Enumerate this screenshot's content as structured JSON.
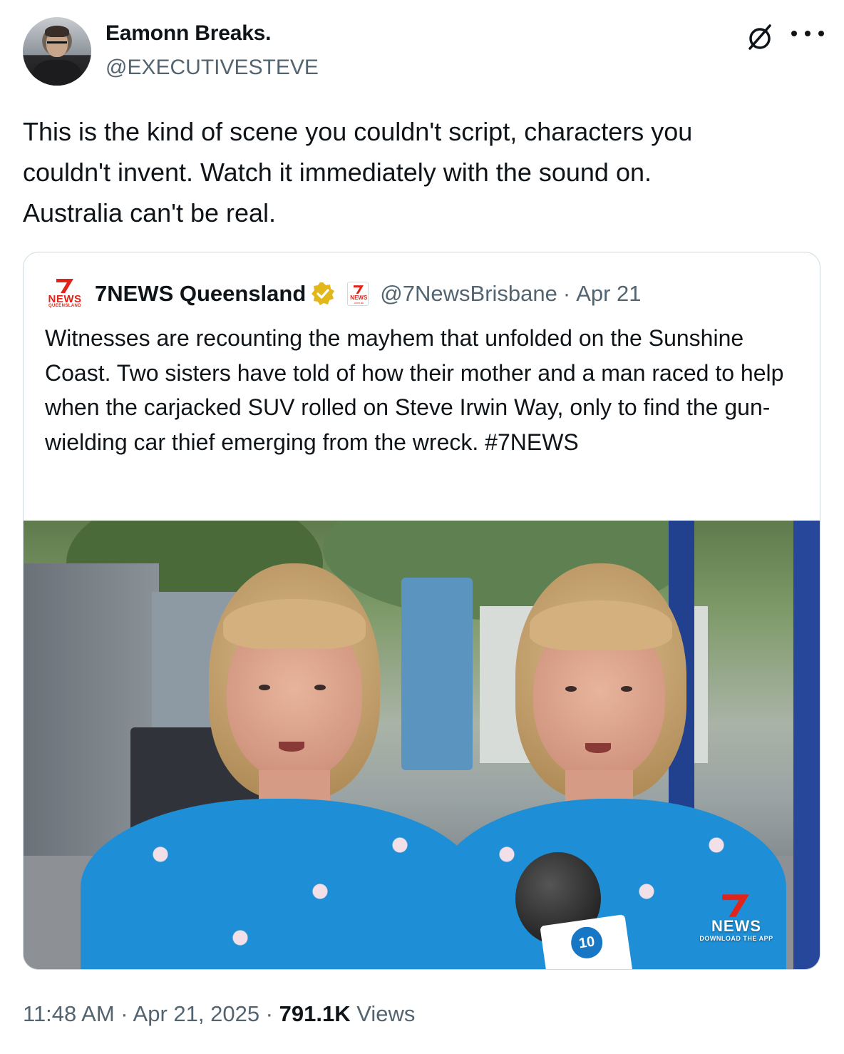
{
  "author": {
    "name": "Eamonn Breaks.",
    "handle": "@EXECUTIVESTEVE"
  },
  "tweet": {
    "text": "This is the kind of scene you couldn't script, characters you\ncouldn't invent.  Watch it immediately with the sound on.\nAustralia can't be real."
  },
  "quoted": {
    "logo_text": "NEWS",
    "logo_subtext": "QUEENSLAND",
    "name": "7NEWS Queensland",
    "affiliate_badge_text": "NEWS",
    "affiliate_badge_subtext": ".com.au",
    "handle": "@7NewsBrisbane",
    "separator": "·",
    "date": "Apr 21",
    "text": "Witnesses are recounting the mayhem that unfolded on the Sunshine Coast. Two sisters have told of how their mother and a man raced to help when the carjacked SUV rolled on Steve Irwin Way, only to find the gun-wielding car thief emerging from the wreck.  #7NEWS",
    "media": {
      "bug_text": "NEWS",
      "bug_subtext": "DOWNLOAD THE APP",
      "mic_flag_text": "10"
    }
  },
  "meta": {
    "time": "11:48 AM",
    "sep1": " · ",
    "date": "Apr 21, 2025",
    "sep2": " · ",
    "views_count": "791.1K",
    "views_label": " Views"
  },
  "colors": {
    "text_primary": "#0f1419",
    "text_secondary": "#536471",
    "border": "#cfd9de",
    "verified_gold": "#e2b719",
    "brand_red": "#e2231a",
    "scrubs_blue": "#1e8fd6"
  },
  "icons": {
    "grok": "grok-icon",
    "more": "more-icon",
    "verified": "verified-gold-icon"
  }
}
